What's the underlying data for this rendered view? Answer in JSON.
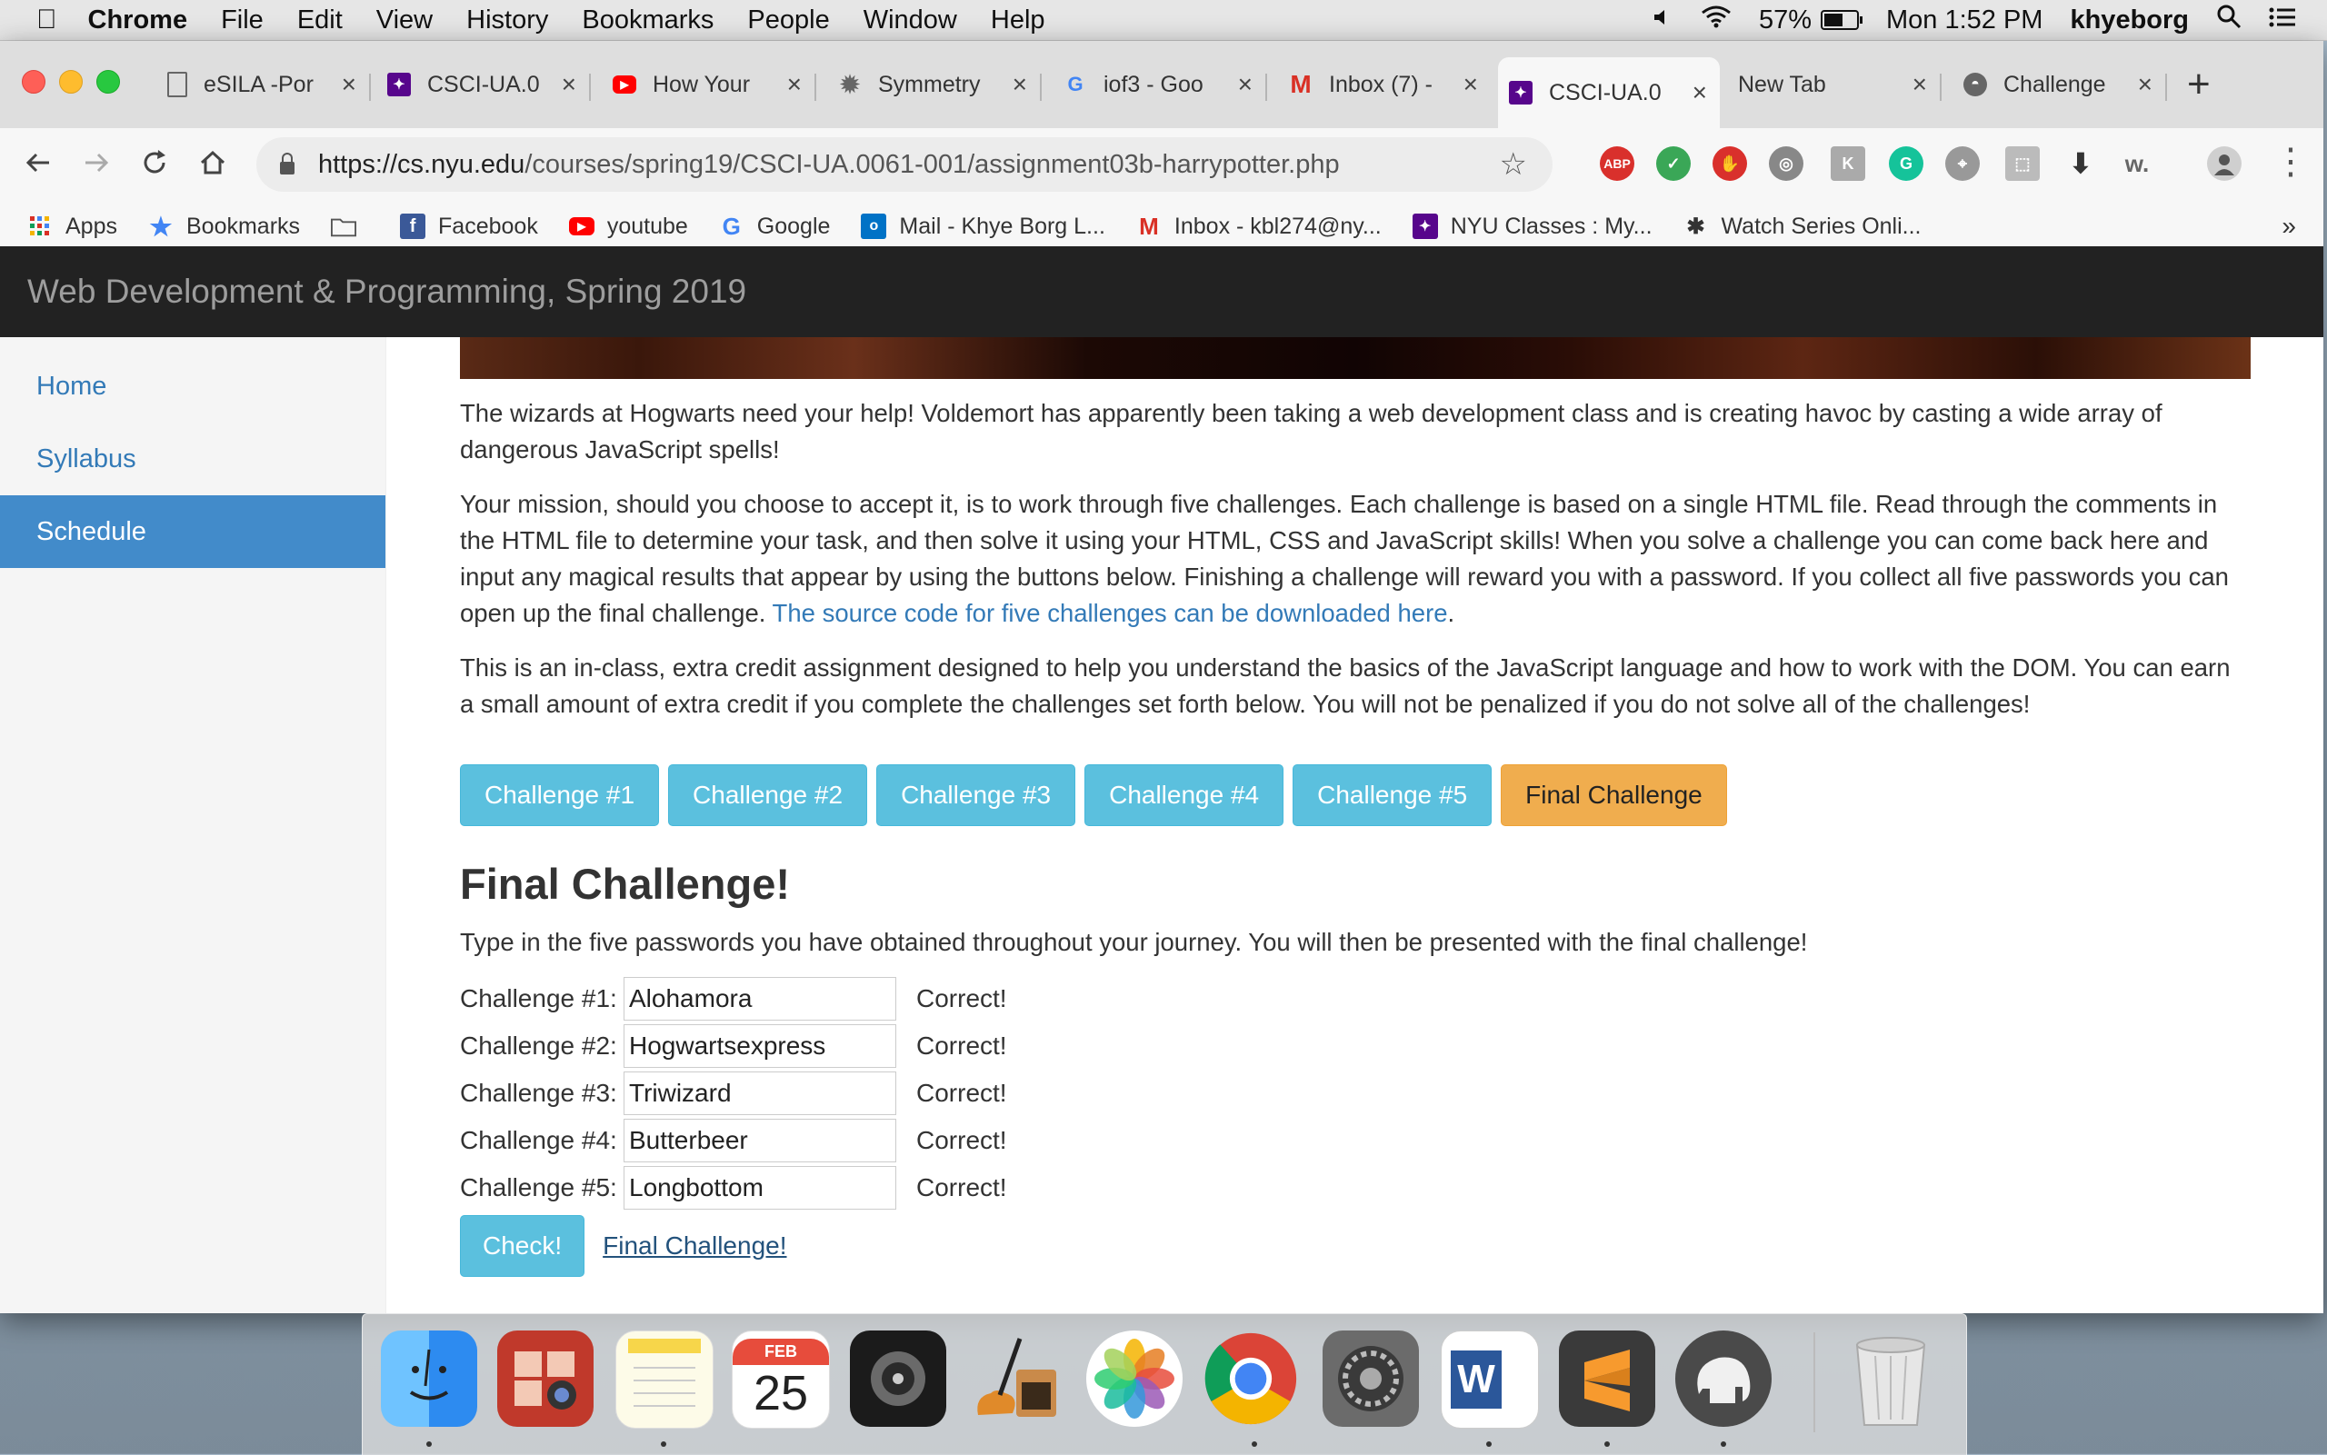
{
  "menubar": {
    "apple": "",
    "app": "Chrome",
    "items": [
      "File",
      "Edit",
      "View",
      "History",
      "Bookmarks",
      "People",
      "Window",
      "Help"
    ],
    "battery": "57%",
    "clock": "Mon 1:52 PM",
    "user": "khyeborg"
  },
  "tabs": [
    {
      "label": "eSILA -Por",
      "icon": "document-icon"
    },
    {
      "label": "CSCI-UA.0",
      "icon": "nyu-icon"
    },
    {
      "label": "How Your",
      "icon": "youtube-icon"
    },
    {
      "label": "Symmetry",
      "icon": "gear-icon"
    },
    {
      "label": "iof3 - Goo",
      "icon": "google-icon"
    },
    {
      "label": "Inbox (7) -",
      "icon": "gmail-icon"
    },
    {
      "label": "CSCI-UA.0",
      "icon": "nyu-icon",
      "active": true
    },
    {
      "label": "New Tab",
      "icon": ""
    },
    {
      "label": "Challenge",
      "icon": "github-icon"
    }
  ],
  "omnibox": {
    "host": "https://cs.nyu.edu",
    "path": "/courses/spring19/CSCI-UA.0061-001/assignment03b-harrypotter.php"
  },
  "extensions": [
    {
      "name": "adblock-plus-icon",
      "label": "ABP",
      "color": "#d9302c"
    },
    {
      "name": "shield-icon",
      "label": "✓",
      "color": "#3aa757"
    },
    {
      "name": "stop-hand-icon",
      "label": "✋",
      "color": "#d9302c"
    },
    {
      "name": "reel-icon",
      "label": "◎",
      "color": "#888"
    },
    {
      "name": "ext-k-icon",
      "label": "K",
      "color": "#aaa"
    },
    {
      "name": "grammarly-icon",
      "label": "G",
      "color": "#15c39a"
    },
    {
      "name": "satellite-icon",
      "label": "⌖",
      "color": "#999"
    },
    {
      "name": "ext-frame-icon",
      "label": "⬚",
      "color": "#bbb"
    },
    {
      "name": "download-icon",
      "label": "⬇",
      "color": "#444"
    },
    {
      "name": "ext-w-icon",
      "label": "w.",
      "color": "#777"
    }
  ],
  "bookmarks": [
    {
      "label": "Apps",
      "icon": "apps-grid-icon"
    },
    {
      "label": "Bookmarks",
      "icon": "star-icon"
    },
    {
      "label": "",
      "icon": "folder-icon"
    },
    {
      "label": "Facebook",
      "icon": "facebook-icon"
    },
    {
      "label": "youtube",
      "icon": "youtube-icon"
    },
    {
      "label": "Google",
      "icon": "google-icon"
    },
    {
      "label": "Mail - Khye Borg L...",
      "icon": "outlook-icon"
    },
    {
      "label": "Inbox - kbl274@ny...",
      "icon": "gmail-icon"
    },
    {
      "label": "NYU Classes : My...",
      "icon": "nyu-icon"
    },
    {
      "label": "Watch Series Onli...",
      "icon": "bug-icon"
    }
  ],
  "bookmarks_more": "»",
  "site": {
    "brand": "Web Development & Programming, Spring 2019",
    "sidebar": [
      "Home",
      "Syllabus",
      "Schedule"
    ],
    "para1": "The wizards at Hogwarts need your help! Voldemort has apparently been taking a web development class and is creating havoc by casting a wide array of dangerous JavaScript spells!",
    "para2": "Your mission, should you choose to accept it, is to work through five challenges. Each challenge is based on a single HTML file. Read through the comments in the HTML file to determine your task, and then solve it using your HTML, CSS and JavaScript skills! When you solve a challenge you can come back here and input any magical results that appear by using the buttons below. Finishing a challenge will reward you with a password. If you collect all five passwords you can open up the final challenge.",
    "para2_link": "The source code for five challenges can be downloaded here",
    "para3": "This is an in-class, extra credit assignment designed to help you understand the basics of the JavaScript language and how to work with the DOM. You can earn a small amount of extra credit if you complete the challenges set forth below. You will not be penalized if you do not solve all of the challenges!",
    "buttons": [
      "Challenge #1",
      "Challenge #2",
      "Challenge #3",
      "Challenge #4",
      "Challenge #5",
      "Final Challenge"
    ],
    "heading": "Final Challenge!",
    "instructions": "Type in the five passwords you have obtained throughout your journey. You will then be presented with the final challenge!",
    "rows": [
      {
        "label": "Challenge #1:",
        "value": "Alohamora",
        "status": "Correct!"
      },
      {
        "label": "Challenge #2:",
        "value": "Hogwartsexpress",
        "status": "Correct!"
      },
      {
        "label": "Challenge #3:",
        "value": "Triwizard",
        "status": "Correct!"
      },
      {
        "label": "Challenge #4:",
        "value": "Butterbeer",
        "status": "Correct!"
      },
      {
        "label": "Challenge #5:",
        "value": "Longbottom",
        "status": "Correct!"
      }
    ],
    "check_button": "Check!",
    "final_link": "Final Challenge!"
  },
  "dock": [
    {
      "name": "finder-icon",
      "label": "☺",
      "color": "#2d8bf0"
    },
    {
      "name": "photo-booth-icon",
      "label": "◉",
      "color": "#c0392b"
    },
    {
      "name": "notes-icon",
      "label": "≡",
      "color": "#f7d64a"
    },
    {
      "name": "calendar-icon",
      "label": "25",
      "month": "FEB",
      "color": "#ffffff"
    },
    {
      "name": "logic-pro-icon",
      "label": "◎",
      "color": "#1b1b1b"
    },
    {
      "name": "garageband-icon",
      "label": "♫",
      "color": "#e08a2a"
    },
    {
      "name": "photos-icon",
      "label": "✿",
      "color": "#ffffff"
    },
    {
      "name": "chrome-icon",
      "label": "◉",
      "color": "#db4437"
    },
    {
      "name": "system-preferences-icon",
      "label": "⚙",
      "color": "#6b6b6b"
    },
    {
      "name": "word-icon",
      "label": "W",
      "color": "#2b579a"
    },
    {
      "name": "sublime-text-icon",
      "label": "S",
      "color": "#3a3a3a"
    },
    {
      "name": "sequel-pro-icon",
      "label": "◕",
      "color": "#4a4a4a"
    },
    {
      "name": "trash-icon",
      "label": "🗑",
      "color": "#d8d8d8"
    }
  ]
}
